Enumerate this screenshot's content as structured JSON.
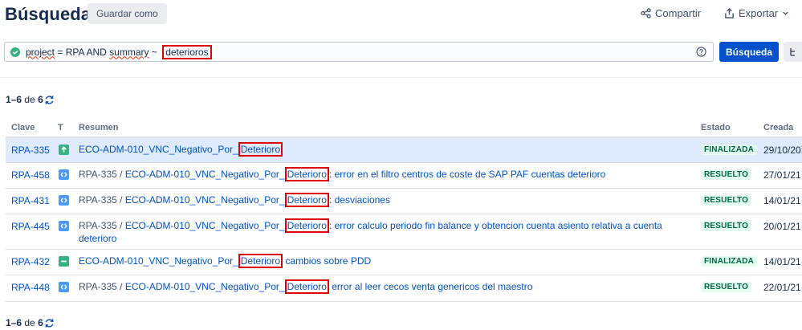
{
  "header": {
    "title": "Búsqueda",
    "save_as": "Guardar como",
    "share": "Compartir",
    "export": "Exportar"
  },
  "jql": {
    "w1": "project",
    "w2": " = RPA AND ",
    "w3": "summary",
    "w4": " ~ ",
    "term": "deterioros",
    "search_button": "Búsqueda"
  },
  "results": {
    "range": "1–6",
    "de": "de",
    "total": "6"
  },
  "table": {
    "headers": {
      "key": "Clave",
      "type": "T",
      "summary": "Resumen",
      "status": "Estado",
      "created": "Creada"
    },
    "rows": [
      {
        "key": "RPA-335",
        "type": "story",
        "parent": "",
        "pre": "ECO-ADM-010_VNC_Negativo_Por_",
        "hl": "Deterioro",
        "post": "",
        "status": "FINALIZADA",
        "created": "29/10/20"
      },
      {
        "key": "RPA-458",
        "type": "subtask",
        "parent": "RPA-335 / ",
        "pre": "ECO-ADM-010_VNC_Negativo_Por_",
        "hl": "Deterioro",
        "post": ": error en el filtro centros de coste de SAP PAF cuentas deterioro",
        "status": "RESUELTO",
        "created": "27/01/21"
      },
      {
        "key": "RPA-431",
        "type": "subtask",
        "parent": "RPA-335 / ",
        "pre": "ECO-ADM-010_VNC_Negativo_Por_",
        "hl": "Deterioro",
        "post": ": desviaciones",
        "status": "RESUELTO",
        "created": "14/01/21"
      },
      {
        "key": "RPA-445",
        "type": "subtask",
        "parent": "RPA-335 / ",
        "pre": "ECO-ADM-010_VNC_Negativo_Por_",
        "hl": "Deterioro",
        "post": ": error calculo periodo fin balance y obtencion cuenta asiento relativa a cuenta deterioro",
        "status": "RESUELTO",
        "created": "20/01/21"
      },
      {
        "key": "RPA-432",
        "type": "task",
        "parent": "",
        "pre": "ECO-ADM-010_VNC_Negativo_Por_",
        "hl": "Deterioro",
        "post": " cambios sobre PDD",
        "status": "FINALIZADA",
        "created": "14/01/21"
      },
      {
        "key": "RPA-448",
        "type": "subtask",
        "parent": "RPA-335 / ",
        "pre": "ECO-ADM-010_VNC_Negativo_Por_",
        "hl": "Deterioro",
        "post": " error al leer cecos venta genericos del maestro",
        "status": "RESUELTO",
        "created": "22/01/21"
      }
    ]
  },
  "colors": {
    "story": "#36b37e",
    "subtask": "#4c9aff",
    "task": "#36b37e",
    "primary": "#0052cc",
    "highlight_box": "#e00000"
  }
}
